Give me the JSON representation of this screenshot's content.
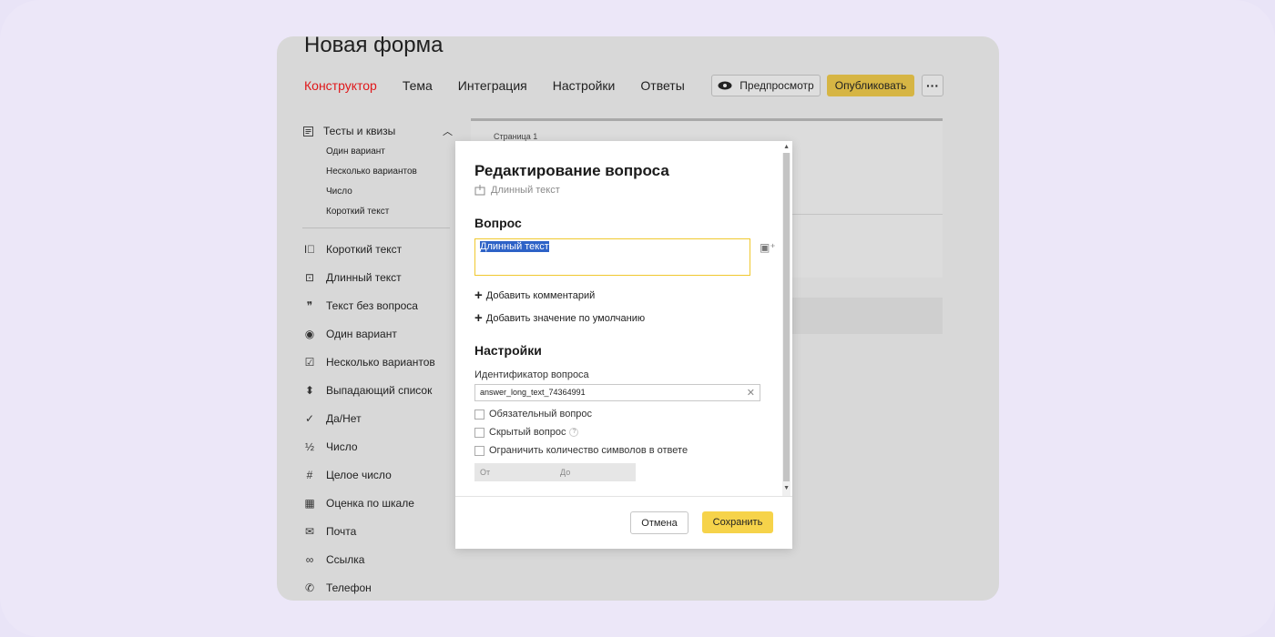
{
  "page": {
    "title": "Новая форма"
  },
  "tabs": [
    {
      "label": "Конструктор",
      "active": true
    },
    {
      "label": "Тема"
    },
    {
      "label": "Интеграция"
    },
    {
      "label": "Настройки"
    },
    {
      "label": "Ответы"
    }
  ],
  "toolbar": {
    "preview_label": "Предпросмотр",
    "publish_label": "Опубликовать",
    "more_label": "···"
  },
  "sidebar": {
    "group": {
      "label": "Тесты и квизы",
      "items": [
        "Один вариант",
        "Несколько вариантов",
        "Число",
        "Короткий текст"
      ]
    },
    "items": [
      {
        "label": "Короткий текст",
        "icon": "short-text-icon",
        "glyph": "I⃕"
      },
      {
        "label": "Длинный текст",
        "icon": "long-text-icon",
        "glyph": "⊡"
      },
      {
        "label": "Текст без вопроса",
        "icon": "quote-icon",
        "glyph": "❞"
      },
      {
        "label": "Один вариант",
        "icon": "radio-icon",
        "glyph": "◉"
      },
      {
        "label": "Несколько вариантов",
        "icon": "checkbox-icon",
        "glyph": "☑"
      },
      {
        "label": "Выпадающий список",
        "icon": "dropdown-icon",
        "glyph": "⬍"
      },
      {
        "label": "Да/Нет",
        "icon": "check-icon",
        "glyph": "✓"
      },
      {
        "label": "Число",
        "icon": "fraction-icon",
        "glyph": "½"
      },
      {
        "label": "Целое число",
        "icon": "hash-icon",
        "glyph": "#"
      },
      {
        "label": "Оценка по шкале",
        "icon": "grid-icon",
        "glyph": "▦"
      },
      {
        "label": "Почта",
        "icon": "mail-icon",
        "glyph": "✉"
      },
      {
        "label": "Ссылка",
        "icon": "link-icon",
        "glyph": "∞"
      },
      {
        "label": "Телефон",
        "icon": "phone-icon",
        "glyph": "✆"
      }
    ]
  },
  "canvas": {
    "page_label": "Страница 1"
  },
  "modal": {
    "title": "Редактирование вопроса",
    "type_label": "Длинный текст",
    "question_heading": "Вопрос",
    "question_value": "Длинный текст",
    "add_comment": "Добавить комментарий",
    "add_default": "Добавить значение по умолчанию",
    "settings_heading": "Настройки",
    "id_label": "Идентификатор вопроса",
    "id_value": "answer_long_text_74364991",
    "required_label": "Обязательный вопрос",
    "hidden_label": "Скрытый вопрос",
    "limit_label": "Ограничить количество символов в ответе",
    "from_placeholder": "От",
    "to_placeholder": "До",
    "cancel_label": "Отмена",
    "save_label": "Сохранить"
  },
  "colors": {
    "accent_red": "#e0171a",
    "save_yellow": "#f6d34a",
    "focus_yellow": "#f0c82e",
    "selection_blue": "#2d62c7"
  }
}
